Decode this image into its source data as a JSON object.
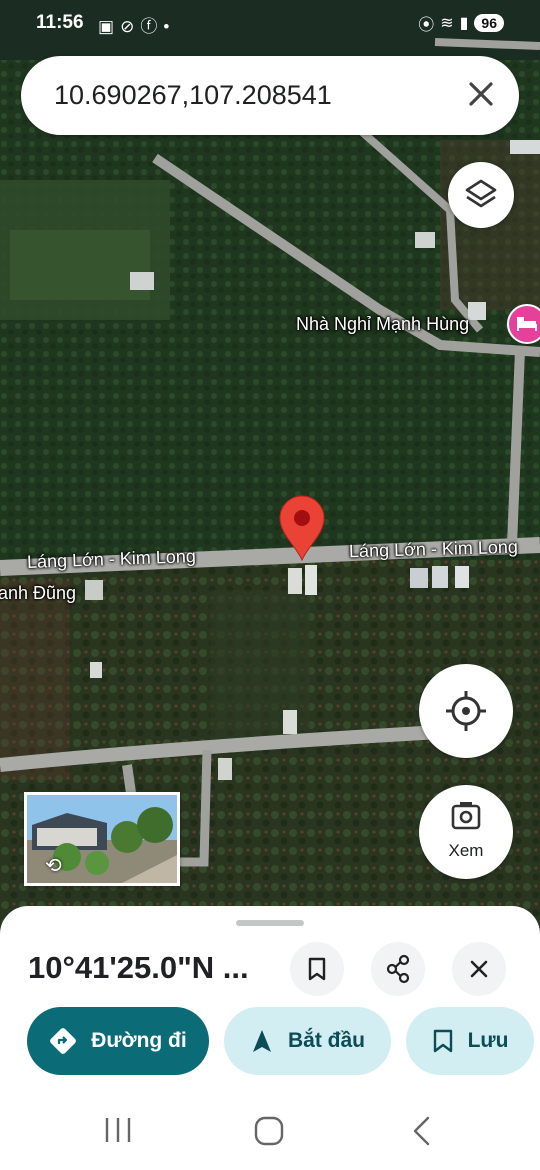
{
  "status_bar": {
    "time": "11:56",
    "left_icons": [
      "screenshot-icon",
      "signal-off-icon",
      "facebook-icon",
      "dot-icon"
    ],
    "battery": "96"
  },
  "search": {
    "query": "10.690267,107.208541"
  },
  "map": {
    "labels": {
      "road_left": "Láng Lớn - Kim Long",
      "road_right": "Láng Lớn - Kim Long",
      "place_partial": "anh Đũng",
      "poi_name": "Nhà Nghỉ Mạnh Hùng"
    },
    "poi_icon": "hotel-bed-icon",
    "pin_color": "#ea4335"
  },
  "controls": {
    "view_label": "Xem"
  },
  "sheet": {
    "title": "10°41'25.0\"N ...",
    "directions_label": "Đường đi",
    "start_label": "Bắt đầu",
    "save_label": "Lưu"
  },
  "colors": {
    "accent": "#0b6b76",
    "secondary_button": "#d3eef2",
    "poi": "#e5419a"
  }
}
